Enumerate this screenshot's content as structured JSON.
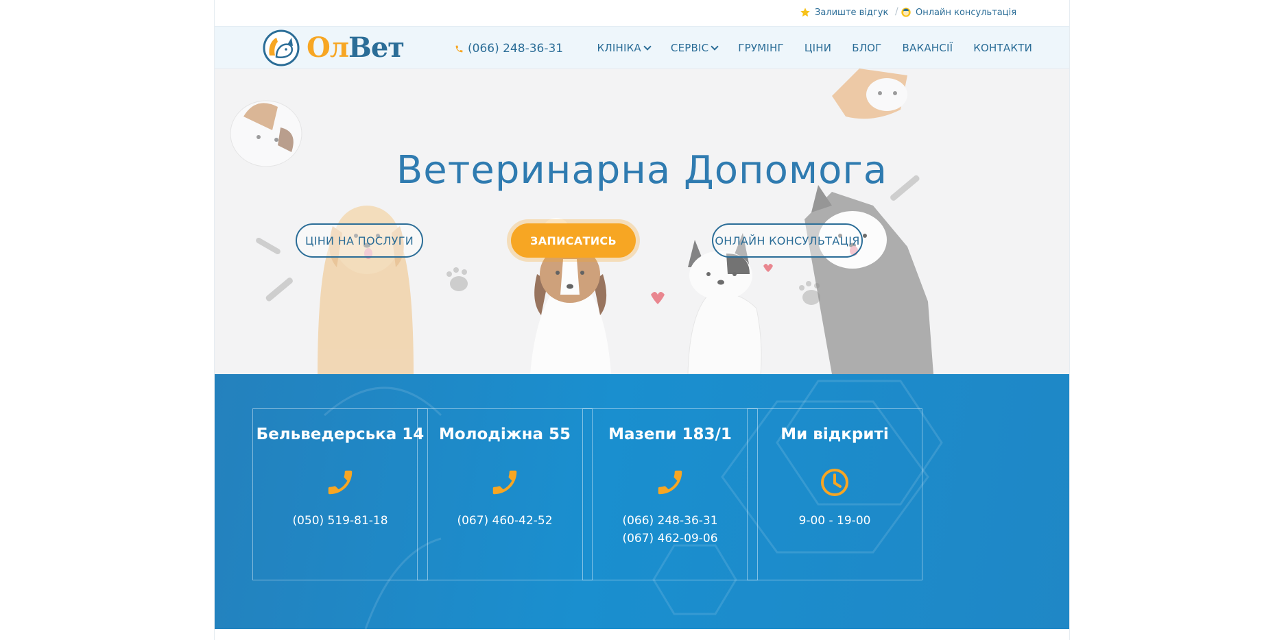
{
  "topbar": {
    "review_label": "Залиште відгук",
    "review_icon": "star-icon",
    "separator": "/",
    "consult_label": "Онлайн консультація",
    "consult_icon": "doctor-avatar-icon"
  },
  "header": {
    "logo_part1": "Ол",
    "logo_part2": "Вет",
    "phone": "(066) 248-36-31",
    "nav": [
      {
        "label": "КЛІНІКА",
        "has_dropdown": true
      },
      {
        "label": "СЕРВІС",
        "has_dropdown": true
      },
      {
        "label": "ГРУМІНГ"
      },
      {
        "label": "ЦІНИ"
      },
      {
        "label": "БЛОГ"
      },
      {
        "label": "ВАКАНСІЇ"
      },
      {
        "label": "КОНТАКТИ"
      }
    ]
  },
  "hero": {
    "title": "Ветеринарна Допомога",
    "buttons": {
      "prices": "ЦІНИ НА ПОСЛУГИ",
      "signup": "ЗАПИСАТИСЬ",
      "online": "ОНЛАЙН КОНСУЛЬТАЦІЯ"
    }
  },
  "cards": [
    {
      "title": "Бельведерська 14",
      "icon": "phone-icon",
      "lines": [
        "(050) 519-81-18"
      ]
    },
    {
      "title": "Молодіжна 55",
      "icon": "phone-icon",
      "lines": [
        "(067) 460-42-52"
      ]
    },
    {
      "title": "Мазепи 183/1",
      "icon": "phone-icon",
      "lines": [
        "(066) 248-36-31",
        "(067) 462-09-06"
      ]
    },
    {
      "title": "Ми відкриті",
      "icon": "clock-icon",
      "lines": [
        "9-00 - 19-00"
      ]
    }
  ],
  "colors": {
    "brand_blue": "#2b6d97",
    "brand_orange": "#f7a623",
    "band_blue": "#1a8fcf"
  }
}
